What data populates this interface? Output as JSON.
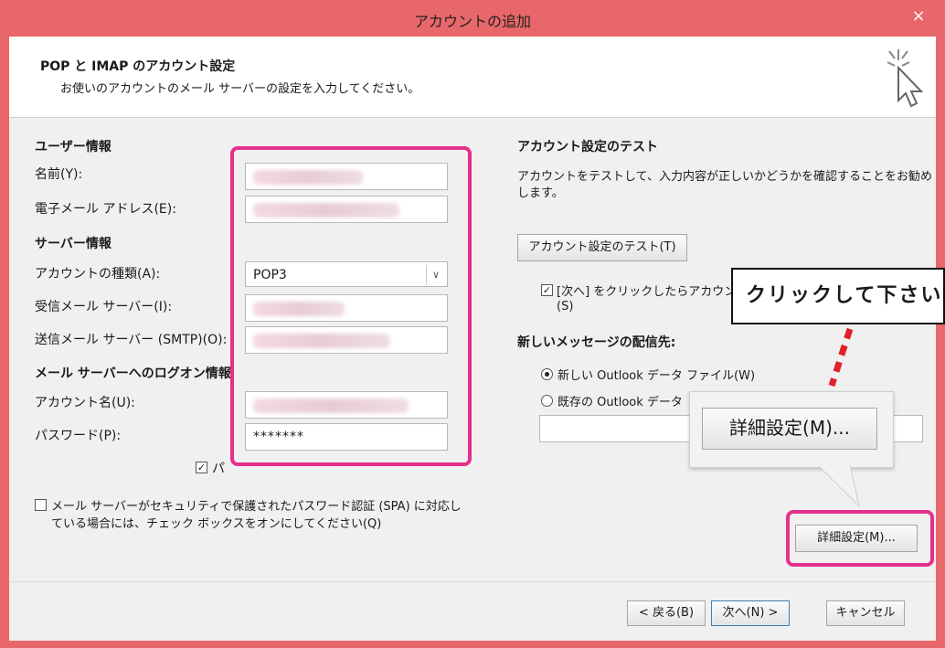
{
  "window": {
    "title": "アカウントの追加",
    "close_glyph": "×"
  },
  "header": {
    "title": "POP と IMAP のアカウント設定",
    "subtitle": "お使いのアカウントのメール サーバーの設定を入力してください。"
  },
  "user_info": {
    "heading": "ユーザー情報",
    "name_label": "名前(Y):",
    "email_label": "電子メール アドレス(E):"
  },
  "server_info": {
    "heading": "サーバー情報",
    "account_type_label": "アカウントの種類(A):",
    "account_type_value": "POP3",
    "incoming_label": "受信メール サーバー(I):",
    "outgoing_label": "送信メール サーバー (SMTP)(O):"
  },
  "logon_info": {
    "heading": "メール サーバーへのログオン情報",
    "account_name_label": "アカウント名(U):",
    "password_label": "パスワード(P):",
    "password_value": "*******",
    "remember_partial": "パ",
    "spa_label_line1": "メール サーバーがセキュリティで保護されたパスワード認証 (SPA) に対応し",
    "spa_label_line2": "ている場合には、チェック ボックスをオンにしてください(Q)"
  },
  "test_section": {
    "heading": "アカウント設定のテスト",
    "desc_line1": "アカウントをテストして、入力内容が正しいかどうかを確認することをお勧め",
    "desc_line2": "します。",
    "test_button": "アカウント設定のテスト(T)",
    "auto_test_line1": "[次へ] をクリックしたらアカウント",
    "auto_test_line2": "(S)"
  },
  "delivery": {
    "heading": "新しいメッセージの配信先:",
    "new_file": "新しい Outlook データ ファイル(W)",
    "existing_file": "既存の Outlook データ"
  },
  "buttons": {
    "more_settings": "詳細設定(M)...",
    "back": "< 戻る(B)",
    "next": "次へ(N) >",
    "cancel": "キャンセル"
  },
  "annotation": {
    "callout": "クリックして下さい",
    "zoom_label": "詳細設定(M)..."
  },
  "colors": {
    "titlebar": "#e8676a",
    "highlight": "#e4308c",
    "arrow": "#e0202a"
  }
}
